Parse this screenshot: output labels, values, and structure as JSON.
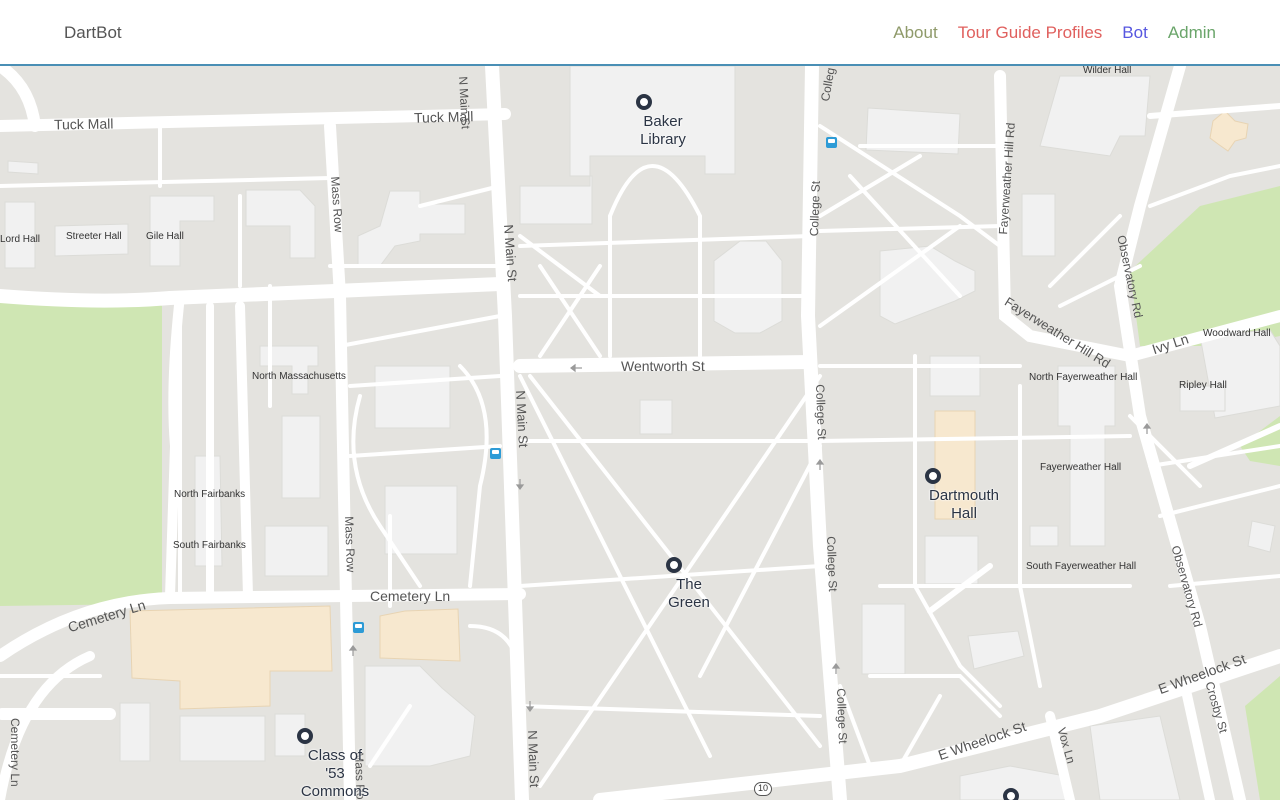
{
  "navbar": {
    "brand": "DartBot",
    "links": [
      {
        "label": "About",
        "color": "#8f9a6a"
      },
      {
        "label": "Tour Guide Profiles",
        "color": "#e0605e"
      },
      {
        "label": "Bot",
        "color": "#5757e0"
      },
      {
        "label": "Admin",
        "color": "#6aa56a"
      }
    ]
  },
  "map": {
    "colors": {
      "land": "#e4e3df",
      "road": "#ffffff",
      "building": "#f1f1f1",
      "park": "#cfe6b3",
      "highlight": "#f7e8cf",
      "pin": "#2b3444",
      "transit": "#2d9bd6"
    },
    "streets": {
      "tuck_mall_1": "Tuck Mall",
      "tuck_mall_2": "Tuck Mall",
      "n_main_st_1": "N Main St",
      "n_main_st_2": "N Main St",
      "n_main_st_3": "N Main St",
      "n_main_st_4": "N Main St",
      "mass_row_1": "Mass Row",
      "mass_row_2": "Mass Row",
      "mass_row_3": "Mass Ro",
      "college_st_1": "College St",
      "college_st_2": "College St",
      "college_st_3": "College St",
      "college_st_4": "College St",
      "college_st_5": "Colleg",
      "wentworth_st": "Wentworth St",
      "cemetery_ln_1": "Cemetery Ln",
      "cemetery_ln_2": "Cemetery Ln",
      "cemetery_ln_3": "Cemetery Ln",
      "fayerweather_hill_rd_1": "Fayerweather Hill Rd",
      "fayerweather_hill_rd_2": "Fayerweather Hill Rd",
      "observatory_rd_1": "Observatory Rd",
      "observatory_rd_2": "Observatory Rd",
      "ivy_ln": "Ivy Ln",
      "e_wheelock_st_1": "E Wheelock St",
      "e_wheelock_st_2": "E Wheelock St",
      "vox_ln": "Vox Ln",
      "crosby_st": "Crosby St",
      "route_10": "10"
    },
    "buildings": {
      "wilder_hall": "Wilder Hall",
      "lord_hall": "Lord Hall",
      "streeter_hall": "Streeter Hall",
      "gile_hall": "Gile Hall",
      "north_massachusetts": "North Massachusetts",
      "north_fairbanks": "North Fairbanks",
      "south_fairbanks": "South Fairbanks",
      "woodward_hall": "Woodward Hall",
      "north_fayerweather_hall": "North Fayerweather Hall",
      "ripley_hall": "Ripley Hall",
      "fayerweather_hall": "Fayerweather Hall",
      "south_fayerweather_hall": "South Fayerweather Hall"
    },
    "pins": {
      "baker_library": {
        "line1": "Baker",
        "line2": "Library",
        "line3": ""
      },
      "the_green": {
        "line1": "The",
        "line2": "Green",
        "line3": ""
      },
      "dartmouth_hall": {
        "line1": "Dartmouth",
        "line2": "Hall",
        "line3": ""
      },
      "class_53_commons": {
        "line1": "Class of",
        "line2": "'53",
        "line3": "Commons"
      },
      "unlabeled_pin": {
        "line1": "",
        "line2": "",
        "line3": ""
      }
    }
  }
}
